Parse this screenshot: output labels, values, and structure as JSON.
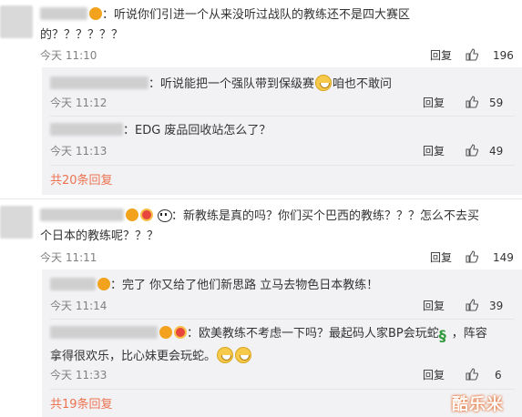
{
  "comments": [
    {
      "text_line1": "：听说你们引进一个从来没听过战队的教练还不是四大赛区",
      "text_line2": "的？？？？？？",
      "time": "今天 11:10",
      "reply_label": "回复",
      "likes": "196",
      "replies": [
        {
          "text_before": "：听说能把一个强队带到保级赛",
          "text_after": "咱也不敢问",
          "time": "今天 11:12",
          "reply_label": "回复",
          "likes": "59"
        },
        {
          "text": "：EDG 废品回收站怎么了？",
          "time": "今天 11:13",
          "reply_label": "回复",
          "likes": "49"
        }
      ],
      "more_label": "共20条回复"
    },
    {
      "text_line1": "：新教练是真的吗？你们买个巴西的教练？？？怎么不去买",
      "text_line2": "个日本的教练呢？？？",
      "time": "今天 11:11",
      "reply_label": "回复",
      "likes": "149",
      "replies": [
        {
          "text": "：完了 你又给了他们新思路 立马去物色日本教练！",
          "time": "今天 11:14",
          "reply_label": "回复",
          "likes": "39"
        },
        {
          "text_line1": "：欧美教练不考虑一下吗？最起码人家BP会玩蛇",
          "text_line1_after": "，阵容",
          "text_line2": "拿得很欢乐，比心妹更会玩蛇。",
          "time": "今天 11:33",
          "reply_label": "回复",
          "likes": "6"
        }
      ],
      "more_label": "共19条回复"
    }
  ],
  "watermark": "酷乐米",
  "icons": {
    "thumb": "thumbs-up-icon",
    "vip": "vip-badge-icon",
    "level": "level-badge-icon",
    "grin": "grin-emoji-icon",
    "snake": "snake-emoji-icon",
    "panda": "panda-emoji-icon"
  },
  "colors": {
    "more_link": "#eb7350",
    "time": "#808080",
    "sub_bg": "#f2f2f5"
  }
}
